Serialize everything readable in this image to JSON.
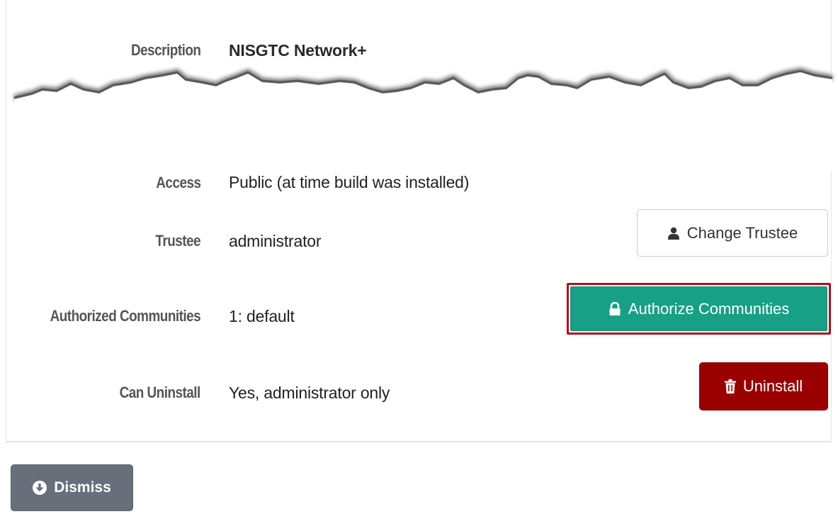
{
  "fields": {
    "description": {
      "label": "Description",
      "value": "NISGTC Network+"
    },
    "access": {
      "label": "Access",
      "value": "Public (at time build was installed)"
    },
    "trustee": {
      "label": "Trustee",
      "value": "administrator"
    },
    "authorized_communities": {
      "label": "Authorized Communities",
      "value": "1: default"
    },
    "can_uninstall": {
      "label": "Can Uninstall",
      "value": "Yes, administrator only"
    }
  },
  "buttons": {
    "change_trustee": {
      "label": "Change Trustee",
      "icon": "user-icon"
    },
    "authorize_communities": {
      "label": "Authorize Communities",
      "icon": "lock-icon",
      "highlight_color": "#b0101e"
    },
    "uninstall": {
      "label": "Uninstall",
      "icon": "trash-icon"
    },
    "dismiss": {
      "label": "Dismiss",
      "icon": "circle-arrow-down-icon"
    }
  },
  "colors": {
    "authorize_bg": "#16a085",
    "uninstall_bg": "#9b0000",
    "dismiss_bg": "#666f7a"
  }
}
